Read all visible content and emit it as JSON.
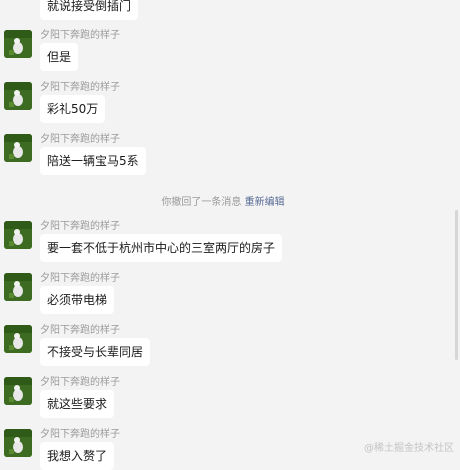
{
  "chat": {
    "sender_name": "夕阳下奔跑的样子",
    "messages": [
      {
        "text": "就说接受倒插门"
      },
      {
        "text": "但是"
      },
      {
        "text": "彩礼50万"
      },
      {
        "text": "陪送一辆宝马5系"
      },
      {
        "text": "要一套不低于杭州市中心的三室两厅的房子"
      },
      {
        "text": "必须带电梯"
      },
      {
        "text": "不接受与长辈同居"
      },
      {
        "text": "就这些要求"
      },
      {
        "text": "我想入赘了"
      }
    ],
    "recall_notice": {
      "text": "你撤回了一条消息",
      "action": "重新编辑"
    }
  },
  "watermark": "@稀土掘金技术社区",
  "colors": {
    "background": "#f3f3f3",
    "bubble": "#ffffff",
    "link": "#576b95",
    "avatar_grass": "#3e6b22"
  },
  "icons": {
    "avatar": "avatar-grass-photo-icon"
  }
}
